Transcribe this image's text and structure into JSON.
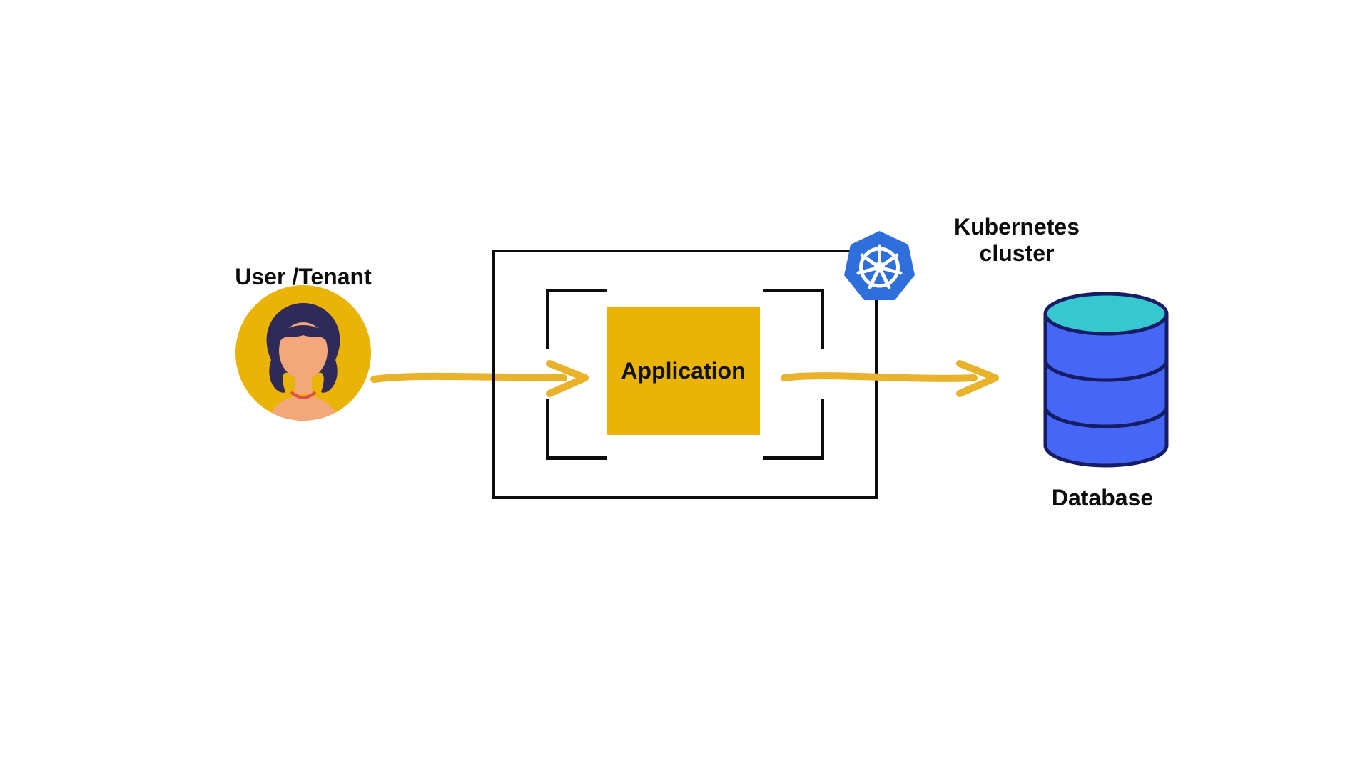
{
  "labels": {
    "user": "User /Tenant",
    "k8s": "Kubernetes cluster",
    "app": "Application",
    "db": "Database"
  },
  "colors": {
    "yellow": "#eab308",
    "arrow": "#e9b22a",
    "skin": "#f3a77b",
    "hair": "#2f2a57",
    "k8s_blue": "#2f6fdb",
    "db_side": "#4666f5",
    "db_top": "#36c7d1",
    "db_stroke": "#141d66"
  },
  "icons": {
    "user": "user-avatar-icon",
    "k8s": "kubernetes-wheel-icon",
    "db": "database-cylinder-icon",
    "arrow": "flow-arrow-icon"
  }
}
